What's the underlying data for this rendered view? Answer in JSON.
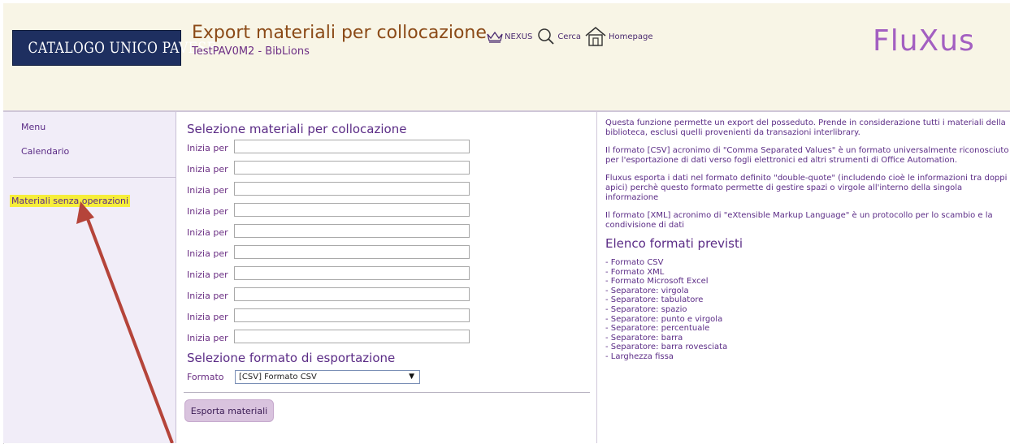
{
  "header": {
    "logo_text": "CATALOGO UNICO PAVESE",
    "title": "Export materiali per collocazione",
    "subtitle": "TestPAV0M2 - BibLions",
    "nav": [
      {
        "label": "NEXUS",
        "icon": "crown-icon"
      },
      {
        "label": "Cerca",
        "icon": "search-icon"
      },
      {
        "label": "Homepage",
        "icon": "home-icon"
      }
    ],
    "brand": "FluXus"
  },
  "sidebar": {
    "items": [
      {
        "label": "Menu"
      },
      {
        "label": "Calendario"
      },
      {
        "label": "Materiali senza operazioni"
      }
    ]
  },
  "form": {
    "section1_title": "Selezione materiali per collocazione",
    "rows": [
      {
        "label": "Inizia per",
        "value": ""
      },
      {
        "label": "Inizia per",
        "value": ""
      },
      {
        "label": "Inizia per",
        "value": ""
      },
      {
        "label": "Inizia per",
        "value": ""
      },
      {
        "label": "Inizia per",
        "value": ""
      },
      {
        "label": "Inizia per",
        "value": ""
      },
      {
        "label": "Inizia per",
        "value": ""
      },
      {
        "label": "Inizia per",
        "value": ""
      },
      {
        "label": "Inizia per",
        "value": ""
      },
      {
        "label": "Inizia per",
        "value": ""
      }
    ],
    "section2_title": "Selezione formato di esportazione",
    "format_label": "Formato",
    "format_selected": "[CSV] Formato CSV",
    "export_button": "Esporta materiali"
  },
  "info": {
    "paragraphs": [
      "Questa funzione permette un export del posseduto. Prende in considerazione tutti i materiali della biblioteca, esclusi quelli provenienti da transazioni interlibrary.",
      "Il formato [CSV] acronimo di \"Comma Separated Values\" è un formato universalmente riconosciuto per l'esportazione di dati verso fogli elettronici ed altri strumenti di Office Automation.",
      "Fluxus esporta i dati nel formato definito \"double-quote\" (includendo cioè le informazioni tra doppi apici) perchè questo formato permette di gestire spazi o virgole all'interno della singola informazione",
      "Il formato [XML] acronimo di \"eXtensible Markup Language\" è un protocollo per lo scambio e la condivisione di dati"
    ],
    "formats_title": "Elenco formati previsti",
    "formats": [
      "- Formato CSV",
      "- Formato XML",
      "- Formato Microsoft Excel",
      "- Separatore: virgola",
      "- Separatore: tabulatore",
      "- Separatore: spazio",
      "- Separatore: punto e virgola",
      "- Separatore: percentuale",
      "- Separatore: barra",
      "- Separatore: barra rovesciata",
      "- Larghezza fissa"
    ]
  },
  "colors": {
    "accent_purple": "#5b2c86",
    "title_brown": "#8b4a17",
    "highlight_yellow": "#f6ee3a",
    "annotation_red": "#b5443a"
  }
}
